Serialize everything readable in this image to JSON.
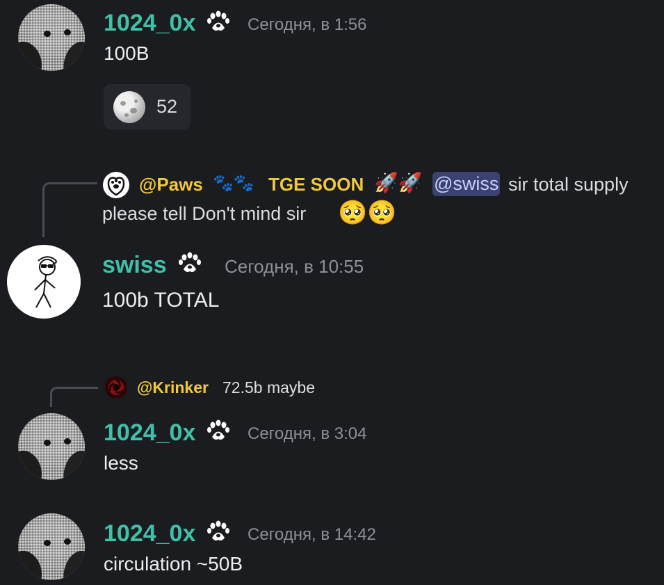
{
  "messages": [
    {
      "author": "1024_0x",
      "timestamp": "Сегодня, в 1:56",
      "text": "100B",
      "reaction": {
        "emoji": "moon",
        "count": "52"
      }
    },
    {
      "reply": {
        "author": "@Paws",
        "author_tail": "TGE SOON",
        "mention": "@swiss",
        "text_after_mention": "sir total supply",
        "text_line2": "please tell  Don't mind sir"
      },
      "author": "swiss",
      "timestamp": "Сегодня, в 10:55",
      "text": "100b TOTAL"
    },
    {
      "reply": {
        "author": "@Krinker",
        "text": "72.5b maybe"
      },
      "author": "1024_0x",
      "timestamp": "Сегодня, в 3:04",
      "text": "less"
    },
    {
      "author": "1024_0x",
      "timestamp": "Сегодня, в 14:42",
      "text": "circulation ~50B"
    }
  ],
  "colors": {
    "background": "#1b1c20",
    "username_teal": "#3fc1a8",
    "reply_name_yellow": "#f0c93c",
    "mention_bg": "#3c4270",
    "timestamp": "#8e9099"
  }
}
